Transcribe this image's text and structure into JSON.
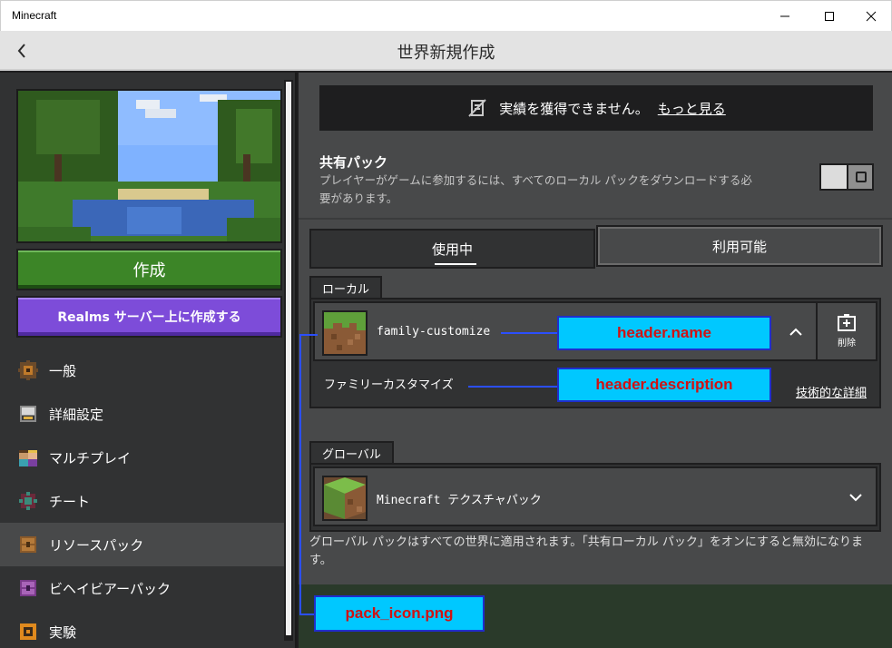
{
  "window": {
    "app_title": "Minecraft",
    "minimize_icon": "minimize-icon",
    "maximize_icon": "maximize-icon",
    "close_icon": "close-icon"
  },
  "header": {
    "title": "世界新規作成",
    "back_icon": "back-arrow-icon"
  },
  "sidebar": {
    "create_label": "作成",
    "realms_label": "Realms サーバー上に作成する",
    "items": [
      {
        "label": "一般",
        "icon": "gear-icon",
        "active": false
      },
      {
        "label": "詳細設定",
        "icon": "advanced-icon",
        "active": false
      },
      {
        "label": "マルチプレイ",
        "icon": "multiplayer-icon",
        "active": false
      },
      {
        "label": "チート",
        "icon": "cheats-icon",
        "active": false
      },
      {
        "label": "リソースパック",
        "icon": "resource-pack-icon",
        "active": true
      },
      {
        "label": "ビヘイビアーパック",
        "icon": "behavior-pack-icon",
        "active": false
      },
      {
        "label": "実験",
        "icon": "experiments-icon",
        "active": false
      }
    ]
  },
  "main": {
    "banner_text": "実績を獲得できません。",
    "banner_link": "もっと見る",
    "shared_pack_title": "共有パック",
    "shared_pack_desc": "プレイヤーがゲームに参加するには、すべてのローカル パックをダウンロードする必要があります。",
    "tabs": [
      {
        "label": "使用中",
        "selected": true
      },
      {
        "label": "利用可能",
        "selected": false
      }
    ],
    "local_label": "ローカル",
    "local_pack": {
      "name": "family-customize",
      "description": "ファミリーカスタマイズ",
      "delete_label": "削除",
      "tech_details": "技術的な詳細"
    },
    "global_label": "グローバル",
    "global_pack": {
      "name": "Minecraft テクスチャパック"
    },
    "global_note": "グローバル パックはすべての世界に適用されます。「共有ローカル パック」をオンにすると無効になります。"
  },
  "annotations": {
    "name": "header.name",
    "description": "header.description",
    "icon": "pack_icon.png"
  },
  "colors": {
    "create_green": "#3c8527",
    "realms_purple": "#7d4cd9",
    "annotation_fill": "#00c8ff",
    "annotation_text": "#d11212"
  }
}
